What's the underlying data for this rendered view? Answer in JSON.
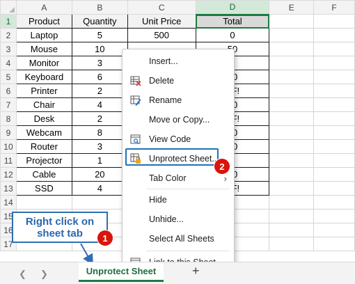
{
  "grid": {
    "columns": [
      "A",
      "B",
      "C",
      "D",
      "E",
      "F"
    ],
    "rows": [
      "1",
      "2",
      "3",
      "4",
      "5",
      "6",
      "7",
      "8",
      "9",
      "10",
      "11",
      "12",
      "13",
      "14",
      "15",
      "16",
      "17"
    ],
    "headers": [
      "Product",
      "Quantity",
      "Unit Price",
      "Total"
    ],
    "data": [
      [
        "Laptop",
        "5",
        "500",
        "0"
      ],
      [
        "Mouse",
        "10",
        "",
        "50"
      ],
      [
        "Monitor",
        "3",
        "",
        "0"
      ],
      [
        "Keyboard",
        "6",
        "",
        "50"
      ],
      [
        "Printer",
        "2",
        "",
        "EF!"
      ],
      [
        "Chair",
        "4",
        "",
        "20"
      ],
      [
        "Desk",
        "2",
        "",
        "EF!"
      ],
      [
        "Webcam",
        "8",
        "",
        "00"
      ],
      [
        "Router",
        "3",
        "",
        "10"
      ],
      [
        "Projector",
        "1",
        "",
        ""
      ],
      [
        "Cable",
        "20",
        "",
        "00"
      ],
      [
        "SSD",
        "4",
        "",
        "EF!"
      ]
    ]
  },
  "context_menu": {
    "items": [
      {
        "label": "Insert...",
        "icon": "none"
      },
      {
        "label": "Delete",
        "icon": "delete-sheet-icon"
      },
      {
        "label": "Rename",
        "icon": "rename-sheet-icon"
      },
      {
        "label": "Move or Copy...",
        "icon": "none"
      },
      {
        "label": "View Code",
        "icon": "view-code-icon"
      },
      {
        "label": "Unprotect Sheet...",
        "icon": "unprotect-sheet-icon"
      },
      {
        "label": "Tab Color",
        "icon": "none"
      },
      {
        "label": "Hide",
        "icon": "none"
      },
      {
        "label": "Unhide...",
        "icon": "none"
      },
      {
        "label": "Select All Sheets",
        "icon": "none"
      },
      {
        "label": "Link to this Sheet",
        "icon": "link-icon"
      }
    ]
  },
  "callout": {
    "line1": "Right click on",
    "line2": "sheet tab"
  },
  "badges": {
    "one": "1",
    "two": "2"
  },
  "tabbar": {
    "sheet_tab": "Unprotect Sheet",
    "add_sheet": "+"
  },
  "colors": {
    "accent_green": "#1d7a44",
    "highlight_blue": "#1e73b8",
    "badge_red": "#d9140a",
    "callout_blue": "#2a67b1"
  }
}
